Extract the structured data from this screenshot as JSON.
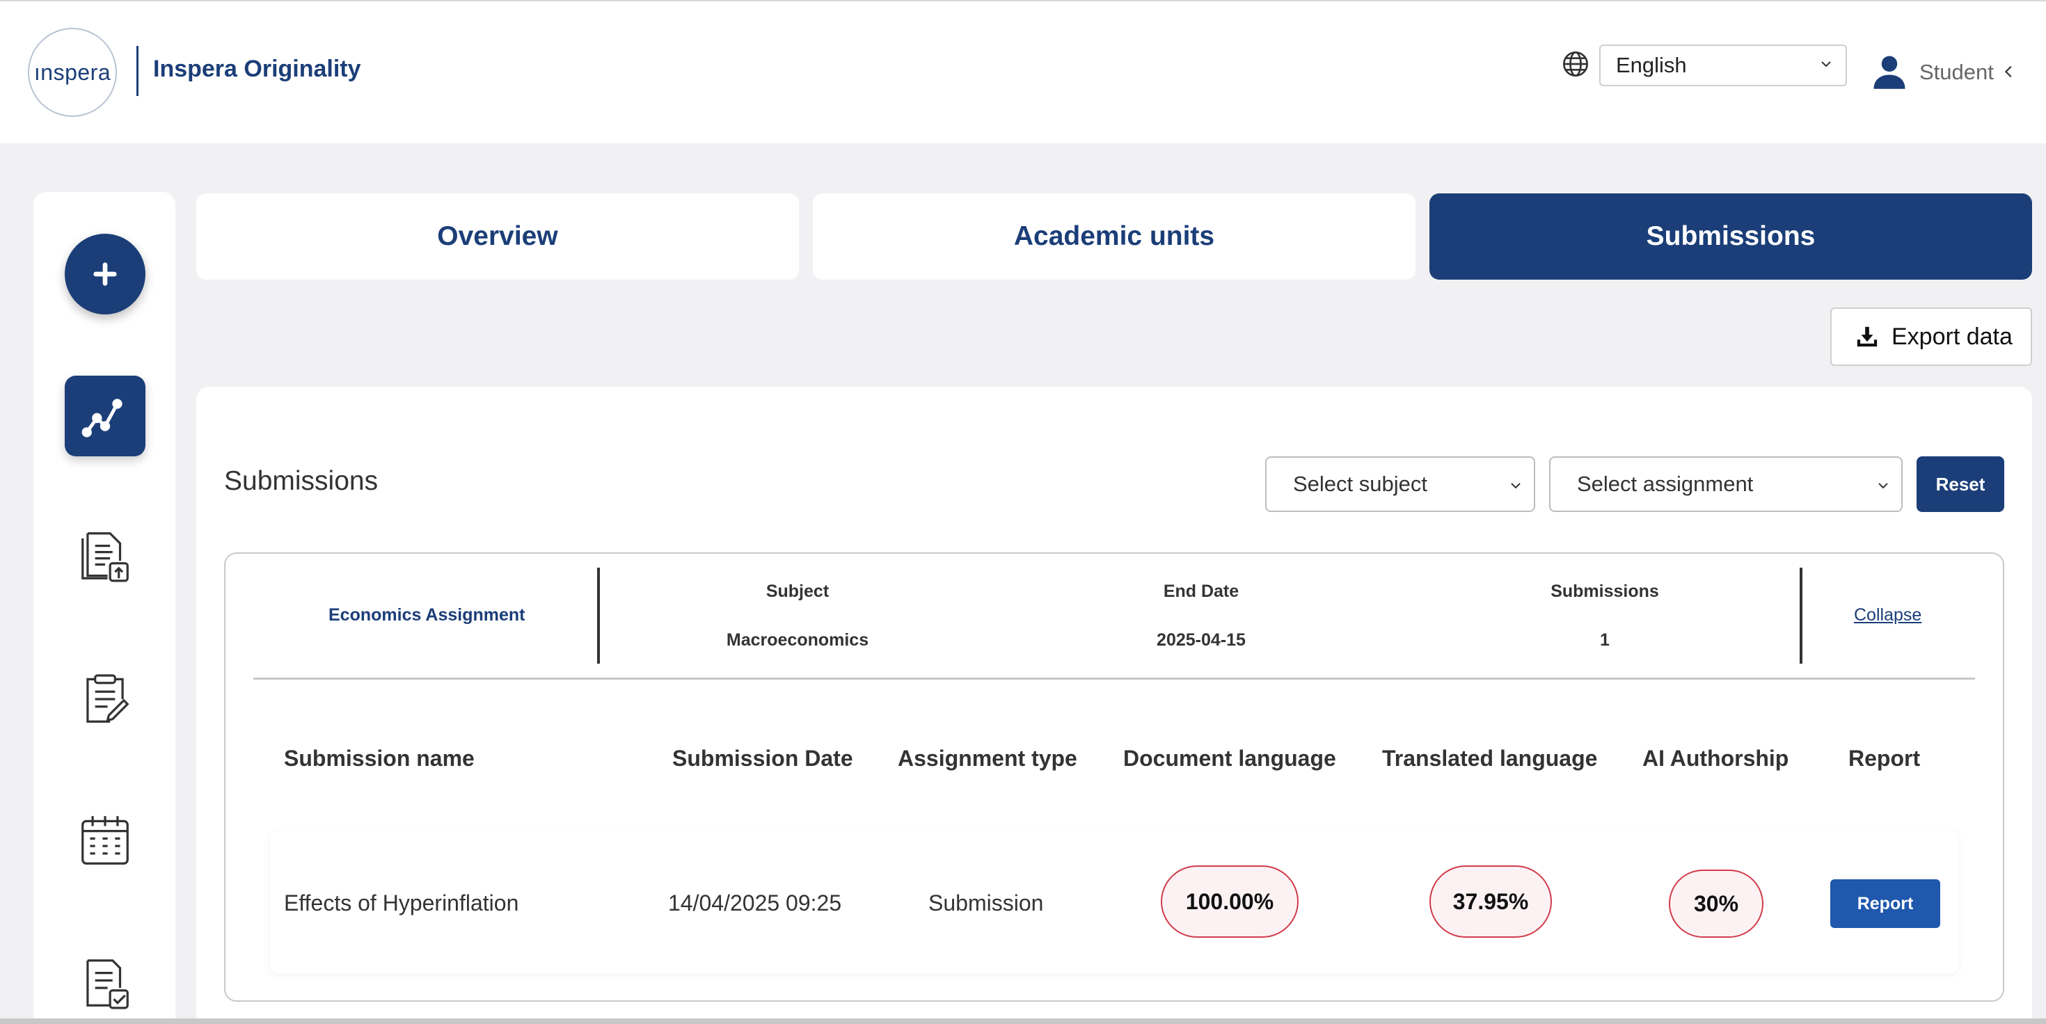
{
  "header": {
    "logo_text": "ınspera",
    "brand": "Inspera Originality",
    "language": "English",
    "user_label": "Student"
  },
  "tabs": [
    {
      "label": "Overview",
      "active": false
    },
    {
      "label": "Academic units",
      "active": false
    },
    {
      "label": "Submissions",
      "active": true
    }
  ],
  "toolbar": {
    "export_label": "Export data"
  },
  "panel": {
    "title": "Submissions",
    "subject_select": "Select subject",
    "assignment_select": "Select assignment",
    "reset_label": "Reset"
  },
  "assignment": {
    "name": "Economics Assignment",
    "subject_header": "Subject",
    "subject_value": "Macroeconomics",
    "end_date_header": "End Date",
    "end_date_value": "2025-04-15",
    "submissions_header": "Submissions",
    "submissions_value": "1",
    "collapse_label": "Collapse"
  },
  "table": {
    "columns": [
      "Submission name",
      "Submission Date",
      "Assignment type",
      "Document language",
      "Translated language",
      "AI Authorship",
      "Report"
    ],
    "rows": [
      {
        "name": "Effects of Hyperinflation",
        "date": "14/04/2025 09:25",
        "type": "Submission",
        "document_language": "100.00%",
        "translated_language": "37.95%",
        "ai_authorship": "30%",
        "report_label": "Report"
      }
    ]
  },
  "colors": {
    "brand": "#1b3e78",
    "accent_button": "#1f58ad",
    "pill_border": "#d23b4b",
    "pill_fill": "#fdf2f3"
  }
}
